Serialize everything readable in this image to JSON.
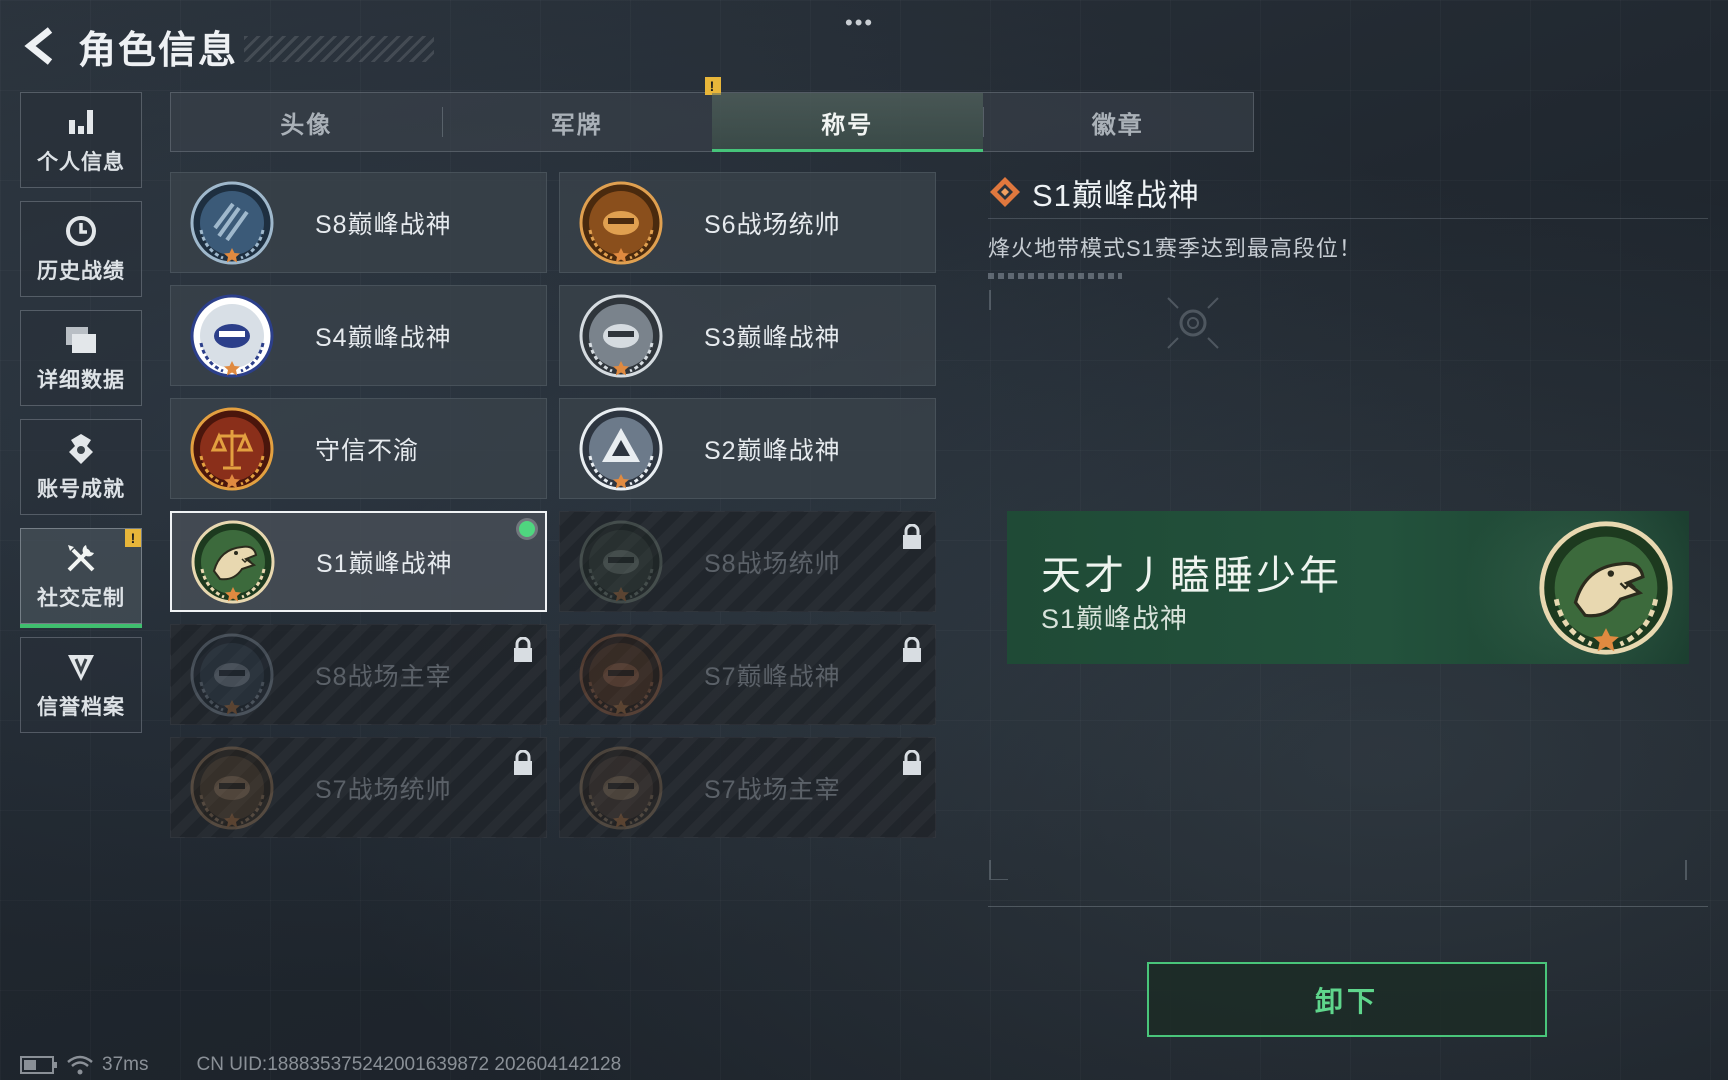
{
  "header": {
    "title": "角色信息",
    "more_label": "•••"
  },
  "sidebar": {
    "items": [
      {
        "label": "个人信息",
        "icon": "bar-chart-icon"
      },
      {
        "label": "历史战绩",
        "icon": "history-icon"
      },
      {
        "label": "详细数据",
        "icon": "folder-icon"
      },
      {
        "label": "账号成就",
        "icon": "achievement-icon"
      },
      {
        "label": "社交定制",
        "icon": "tools-icon",
        "active": true,
        "badge": "!"
      },
      {
        "label": "信誉档案",
        "icon": "credit-icon"
      }
    ]
  },
  "tabs": [
    {
      "label": "头像"
    },
    {
      "label": "军牌",
      "badge": "!"
    },
    {
      "label": "称号",
      "active": true
    },
    {
      "label": "徽章"
    }
  ],
  "titles": [
    {
      "name": "S8巅峰战神",
      "emblem": "s8-peak-emblem",
      "state": "unlocked"
    },
    {
      "name": "S6战场统帅",
      "emblem": "s6-commander-emblem",
      "state": "unlocked"
    },
    {
      "name": "S4巅峰战神",
      "emblem": "s4-peak-emblem",
      "state": "unlocked"
    },
    {
      "name": "S3巅峰战神",
      "emblem": "s3-peak-emblem",
      "state": "unlocked"
    },
    {
      "name": "守信不渝",
      "emblem": "scales-emblem",
      "state": "unlocked"
    },
    {
      "name": "S2巅峰战神",
      "emblem": "s2-peak-emblem",
      "state": "unlocked"
    },
    {
      "name": "S1巅峰战神",
      "emblem": "crocodile-emblem",
      "state": "selected"
    },
    {
      "name": "S8战场统帅",
      "emblem": "tank-emblem",
      "state": "locked"
    },
    {
      "name": "S8战场主宰",
      "emblem": "building-emblem",
      "state": "locked"
    },
    {
      "name": "S7巅峰战神",
      "emblem": "s7-peak-emblem",
      "state": "locked"
    },
    {
      "name": "S7战场统帅",
      "emblem": "vehicle-emblem",
      "state": "locked"
    },
    {
      "name": "S7战场主宰",
      "emblem": "soldier-emblem",
      "state": "locked"
    }
  ],
  "detail": {
    "name": "S1巅峰战神",
    "description": "烽火地带模式S1赛季达到最高段位！"
  },
  "namecard": {
    "player_name": "天才丿瞌睡少年",
    "title": "S1巅峰战神"
  },
  "actions": {
    "unequip_label": "卸下"
  },
  "status": {
    "ping": "37ms",
    "uid": "CN UID:188835375242001639872 202604142128"
  },
  "colors": {
    "accent_green": "#46c47a",
    "warning_yellow": "#e8b63a",
    "namecard_green": "#23523c"
  }
}
